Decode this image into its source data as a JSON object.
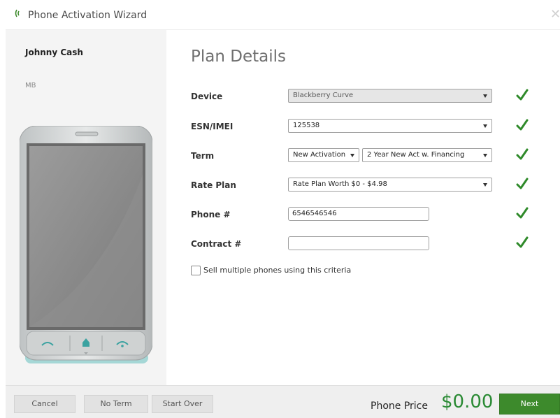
{
  "window": {
    "title": "Phone Activation Wizard",
    "accent": "#2a8a34"
  },
  "sidebar": {
    "user_name": "Johnny Cash",
    "user_sub": "MB"
  },
  "main": {
    "title": "Plan Details",
    "fields": {
      "device": {
        "label": "Device",
        "value": "Blackberry Curve"
      },
      "esn": {
        "label": "ESN/IMEI",
        "value": "125538"
      },
      "term": {
        "label": "Term",
        "value1": "New Activation",
        "value2": "2 Year New Act w. Financing"
      },
      "rate_plan": {
        "label": "Rate Plan",
        "value": "Rate Plan Worth $0 - $4.98"
      },
      "phone": {
        "label": "Phone #",
        "value": "6546546546"
      },
      "contract": {
        "label": "Contract #",
        "value": ""
      }
    },
    "multi_checkbox": {
      "label": "Sell multiple phones using this criteria",
      "checked": false
    }
  },
  "footer": {
    "cancel": "Cancel",
    "no_term": "No Term",
    "start_over": "Start Over",
    "price_label": "Phone Price",
    "price_value": "$0.00",
    "next": "Next"
  },
  "icons": {
    "logo": "signal-icon",
    "close": "close-icon",
    "check": "check-icon",
    "dropdown": "chevron-down-icon"
  }
}
